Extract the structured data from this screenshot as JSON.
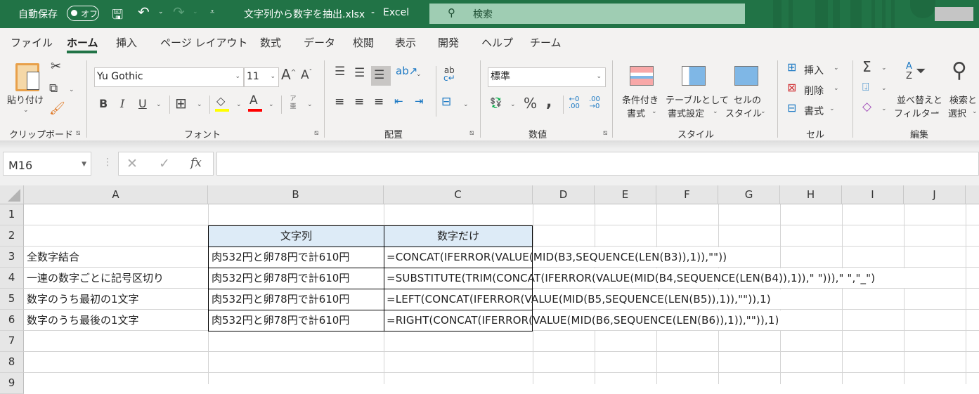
{
  "titlebar": {
    "autosave_label": "自動保存",
    "autosave_state": "オフ",
    "filename": "文字列から数字を抽出.xlsx",
    "separator": "-",
    "app_name": "Excel",
    "search_placeholder": "検索",
    "colors": {
      "brand": "#217346",
      "search_bg": "#9fcdb3"
    }
  },
  "tabs": [
    {
      "label": "ファイル"
    },
    {
      "label": "ホーム",
      "active": true
    },
    {
      "label": "挿入"
    },
    {
      "label": "ページ レイアウト"
    },
    {
      "label": "数式"
    },
    {
      "label": "データ"
    },
    {
      "label": "校閲"
    },
    {
      "label": "表示"
    },
    {
      "label": "開発"
    },
    {
      "label": "ヘルプ"
    },
    {
      "label": "チーム"
    }
  ],
  "ribbon": {
    "clipboard": {
      "paste_label": "貼り付け",
      "group_label": "クリップボード"
    },
    "font": {
      "font_name": "Yu Gothic",
      "font_size": "11",
      "group_label": "フォント",
      "bold": "B",
      "italic": "I",
      "underline": "U",
      "phonetic": "ア亜",
      "fill_color": "#ffff00",
      "font_color": "#ff0000"
    },
    "alignment": {
      "group_label": "配置"
    },
    "number": {
      "format": "標準",
      "percent": "%",
      "comma": "❟",
      "group_label": "数値"
    },
    "styles": {
      "cond_format_1": "条件付き",
      "cond_format_2": "書式",
      "table_1": "テーブルとして",
      "table_2": "書式設定",
      "cell_style_1": "セルの",
      "cell_style_2": "スタイル",
      "group_label": "スタイル"
    },
    "cells": {
      "insert": "挿入",
      "delete": "削除",
      "format": "書式",
      "group_label": "セル"
    },
    "editing": {
      "sort_1": "並べ替えと",
      "sort_2": "フィルター",
      "find_1": "検索と",
      "find_2": "選択",
      "group_label": "編集"
    }
  },
  "formula_bar": {
    "name_box": "M16",
    "fx_label": "fx",
    "formula": ""
  },
  "sheet": {
    "columns": [
      "A",
      "B",
      "C",
      "D",
      "E",
      "F",
      "G",
      "H",
      "I",
      "J"
    ],
    "rows": [
      "1",
      "2",
      "3",
      "4",
      "5",
      "6",
      "7",
      "8",
      "9"
    ],
    "header_row": {
      "b": "文字列",
      "c": "数字だけ"
    },
    "data_rows": [
      {
        "a": "全数字結合",
        "b": "肉532円と卵78円で計610円",
        "c": "=CONCAT(IFERROR(VALUE(MID(B3,SEQUENCE(LEN(B3)),1)),\"\"))"
      },
      {
        "a": "一連の数字ごとに記号区切り",
        "b": "肉532円と卵78円で計610円",
        "c": "=SUBSTITUTE(TRIM(CONCAT(IFERROR(VALUE(MID(B4,SEQUENCE(LEN(B4)),1)),\" \"))),\" \",\"_\")"
      },
      {
        "a": "数字のうち最初の1文字",
        "b": "肉532円と卵78円で計610円",
        "c": "=LEFT(CONCAT(IFERROR(VALUE(MID(B5,SEQUENCE(LEN(B5)),1)),\"\")),1)"
      },
      {
        "a": "数字のうち最後の1文字",
        "b": "肉532円と卵78円で計610円",
        "c": "=RIGHT(CONCAT(IFERROR(VALUE(MID(B6,SEQUENCE(LEN(B6)),1)),\"\")),1)"
      }
    ],
    "header_fill": "#ddebf7"
  }
}
